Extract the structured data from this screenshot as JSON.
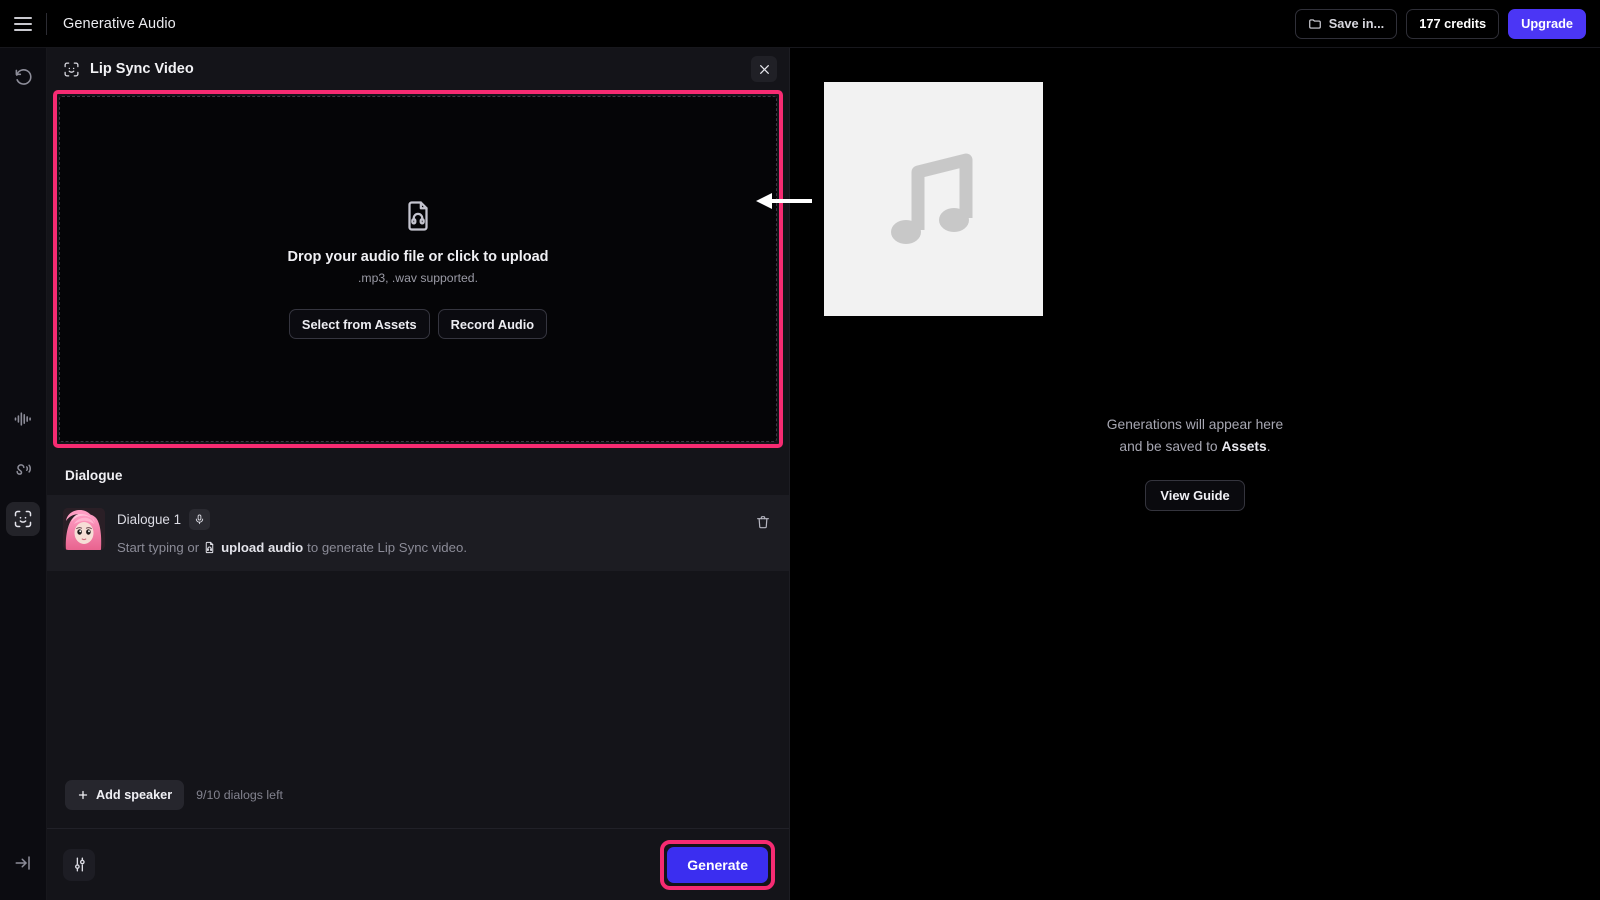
{
  "topbar": {
    "menu_icon": "hamburger-icon",
    "title": "Generative Audio",
    "save_in_label": "Save in...",
    "save_in_icon": "folder-icon",
    "credits_label": "177 credits",
    "upgrade_label": "Upgrade",
    "upgrade_color": "#4b36f5"
  },
  "rail": {
    "items": [
      {
        "name": "history-icon",
        "active": false
      },
      {
        "name": "waveform-icon",
        "active": false
      },
      {
        "name": "voice-icon",
        "active": false
      },
      {
        "name": "face-scan-icon",
        "active": true
      }
    ],
    "collapse_icon": "collapse-panel-icon"
  },
  "panel": {
    "icon": "face-scan-icon",
    "title": "Lip Sync Video",
    "close_icon": "close-icon",
    "dropzone": {
      "icon": "audio-file-icon",
      "title": "Drop your audio file or click to upload",
      "subtitle": ".mp3, .wav supported.",
      "buttons": [
        "Select from Assets",
        "Record Audio"
      ],
      "highlight_color": "#f62b72"
    },
    "dialogue": {
      "section_label": "Dialogue",
      "rows": [
        {
          "avatar": "anime-character-avatar",
          "name": "Dialogue 1",
          "mic_icon": "microphone-icon",
          "placeholder_prefix": "Start typing or",
          "placeholder_link_icon": "audio-file-icon",
          "placeholder_link": "upload audio",
          "placeholder_suffix": "to generate Lip Sync video.",
          "delete_icon": "trash-icon"
        }
      ],
      "add_speaker_label": "Add speaker",
      "add_speaker_icon": "plus-icon",
      "dialogs_left": "9/10 dialogs left"
    },
    "footer": {
      "settings_icon": "sliders-icon",
      "generate_label": "Generate",
      "generate_color": "#3b2ef0",
      "generate_highlight_color": "#f62b72"
    }
  },
  "preview": {
    "thumbnail_icon": "music-note-icon",
    "empty_line1": "Generations will appear here",
    "empty_line2_prefix": "and be saved to ",
    "empty_line2_link": "Assets",
    "empty_line2_suffix": ".",
    "view_guide_label": "View Guide"
  },
  "annotation": {
    "arrow": "left-pointing-arrow",
    "color": "#ffffff"
  }
}
